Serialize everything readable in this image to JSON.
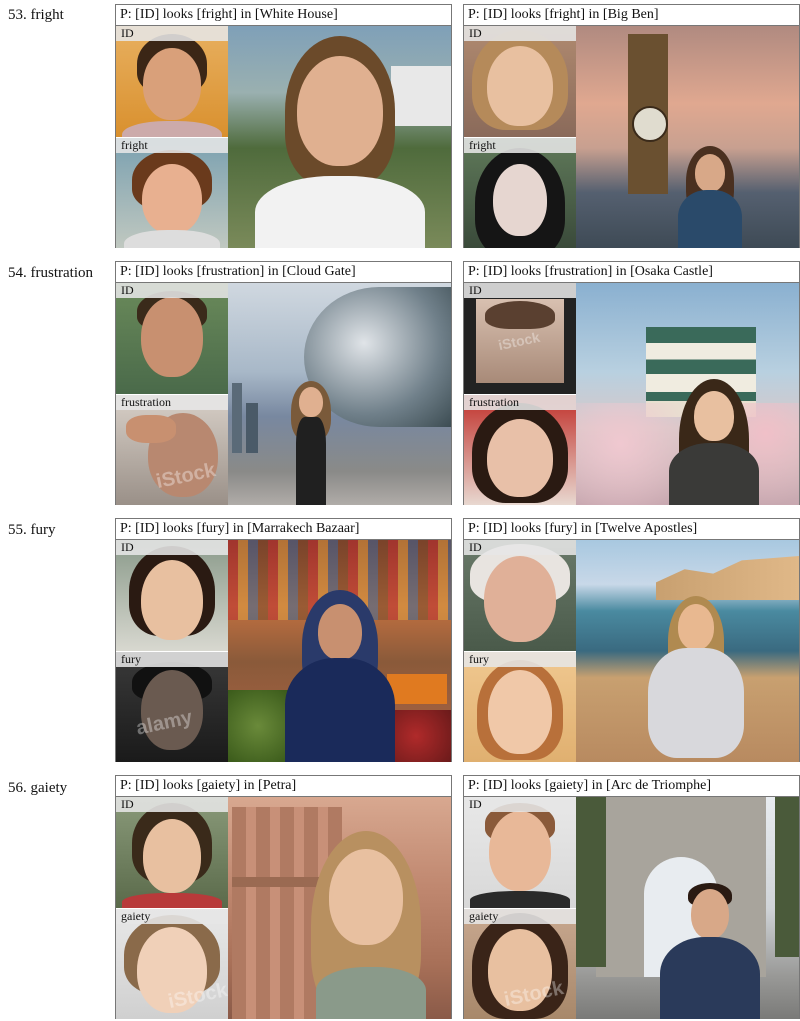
{
  "rows": [
    {
      "label": "53. fright",
      "panels": [
        {
          "caption": "P: [ID] looks [fright] in [White House]",
          "id_tag": "ID",
          "expr_tag": "fright"
        },
        {
          "caption": "P: [ID] looks [fright] in [Big Ben]",
          "id_tag": "ID",
          "expr_tag": "fright"
        }
      ]
    },
    {
      "label": "54. frustration",
      "panels": [
        {
          "caption": "P: [ID] looks [frustration] in [Cloud Gate]",
          "id_tag": "ID",
          "expr_tag": "frustration"
        },
        {
          "caption": "P: [ID] looks [frustration] in [Osaka Castle]",
          "id_tag": "ID",
          "expr_tag": "frustration"
        }
      ]
    },
    {
      "label": "55. fury",
      "panels": [
        {
          "caption": "P: [ID] looks [fury] in [Marrakech Bazaar]",
          "id_tag": "ID",
          "expr_tag": "fury"
        },
        {
          "caption": "P: [ID] looks [fury] in [Twelve Apostles]",
          "id_tag": "ID",
          "expr_tag": "fury"
        }
      ]
    },
    {
      "label": "56. gaiety",
      "panels": [
        {
          "caption": "P: [ID] looks [gaiety] in [Petra]",
          "id_tag": "ID",
          "expr_tag": "gaiety"
        },
        {
          "caption": "P: [ID] looks [gaiety] in [Arc de Triomphe]",
          "id_tag": "ID",
          "expr_tag": "gaiety"
        }
      ]
    }
  ],
  "colors": {
    "border": "#777777",
    "tag_bg": "#e6e6e6"
  }
}
